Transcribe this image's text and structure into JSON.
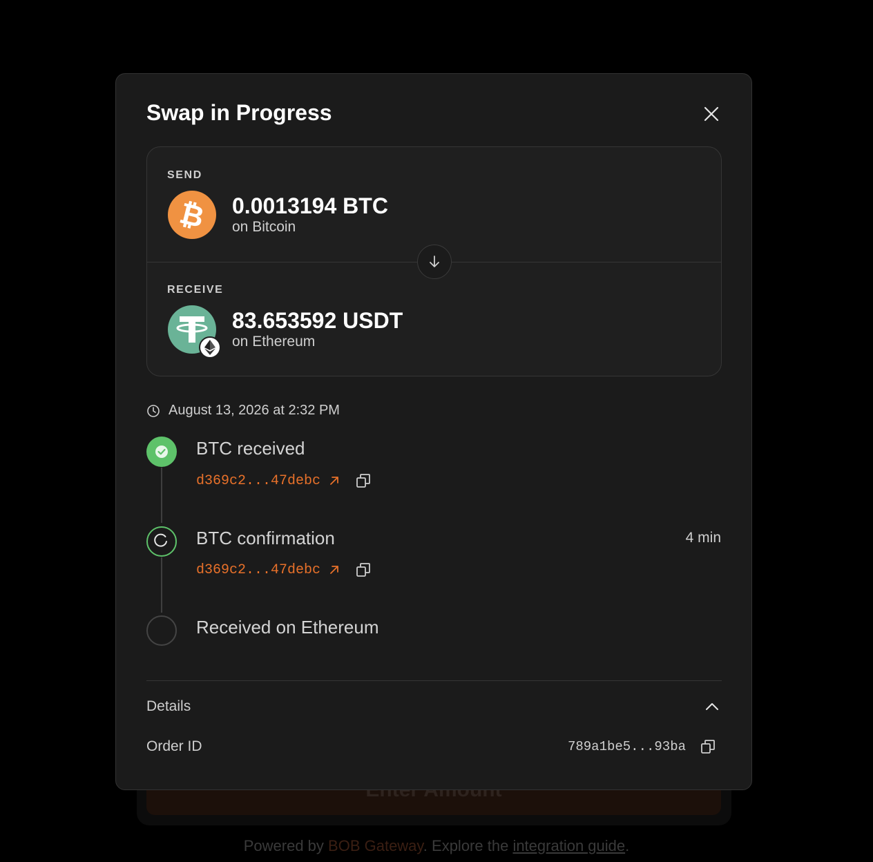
{
  "background": {
    "cta_label": "Enter Amount",
    "footer": {
      "prefix": "Powered by ",
      "brand": "BOB Gateway",
      "middle": ". Explore the ",
      "link": "integration guide",
      "suffix": "."
    }
  },
  "modal": {
    "title": "Swap in Progress",
    "close_icon": "close-icon"
  },
  "swap": {
    "send": {
      "label": "SEND",
      "amount": "0.0013194 BTC",
      "chain": "on Bitcoin",
      "icon": "bitcoin-icon",
      "color": "#f09242"
    },
    "receive": {
      "label": "RECEIVE",
      "amount": "83.653592 USDT",
      "chain": "on Ethereum",
      "icon": "tether-icon",
      "badge_icon": "ethereum-icon",
      "color": "#6ab397"
    },
    "arrow_icon": "arrow-down-icon"
  },
  "timestamp": {
    "icon": "clock-icon",
    "text": "August 13, 2026 at 2:32 PM"
  },
  "steps": [
    {
      "title": "BTC received",
      "status": "complete",
      "tx": "d369c2...47debc",
      "time": ""
    },
    {
      "title": "BTC confirmation",
      "status": "in-progress",
      "tx": "d369c2...47debc",
      "time": "4 min"
    },
    {
      "title": "Received on Ethereum",
      "status": "pending",
      "tx": "",
      "time": ""
    }
  ],
  "details": {
    "label": "Details",
    "expanded": true,
    "order_id_label": "Order ID",
    "order_id_value": "789a1be5...93ba"
  },
  "colors": {
    "accent": "#e8712a",
    "success": "#5ec26a",
    "modal_bg": "#1b1b1b"
  }
}
